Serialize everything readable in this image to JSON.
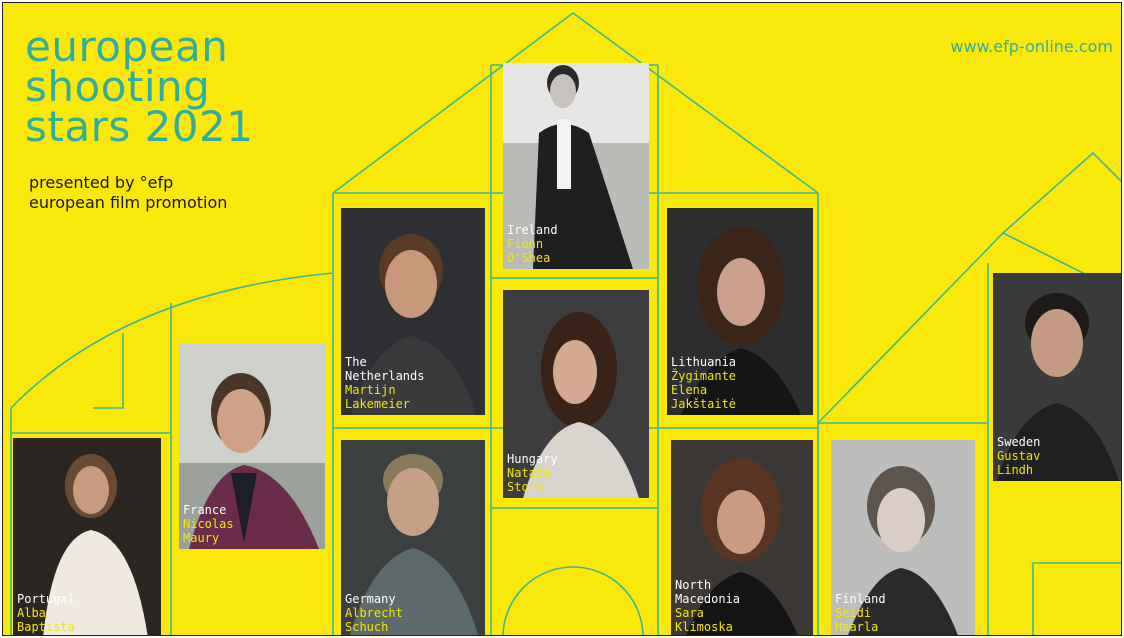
{
  "poster": {
    "title_lines": [
      "european",
      "shooting",
      "stars 2021"
    ],
    "subtitle_lines": [
      "presented by °efp",
      "european film promotion"
    ],
    "url": "www.efp-online.com",
    "background_color": "#fbe80b",
    "accent_color": "#2fae9e"
  },
  "stars": [
    {
      "country": "Portugal",
      "name_lines": [
        "Alba",
        "Baptista"
      ],
      "bg": "dark"
    },
    {
      "country": "France",
      "name_lines": [
        "Nicolas",
        "Maury"
      ],
      "bg": "light"
    },
    {
      "country": "The\nNetherlands",
      "country_lines": [
        "The",
        "Netherlands"
      ],
      "name_lines": [
        "Martijn",
        "Lakemeier"
      ],
      "bg": "dark"
    },
    {
      "country": "Germany",
      "name_lines": [
        "Albrecht",
        "Schuch"
      ],
      "bg": "dark"
    },
    {
      "country": "Ireland",
      "name_lines": [
        "Fionn",
        "O'Shea"
      ],
      "bg": "light"
    },
    {
      "country": "Hungary",
      "name_lines": [
        "Nataša",
        "Stork"
      ],
      "bg": "dark"
    },
    {
      "country": "Lithuania",
      "name_lines": [
        "Žygimante",
        "Elena",
        "Jakštaitė"
      ],
      "bg": "dark"
    },
    {
      "country": "North\nMacedonia",
      "country_lines": [
        "North",
        "Macedonia"
      ],
      "name_lines": [
        "Sara",
        "Klimoska"
      ],
      "bg": "dark"
    },
    {
      "country": "Finland",
      "name_lines": [
        "Seidi",
        "Haarla"
      ],
      "bg": "light"
    },
    {
      "country": "Sweden",
      "name_lines": [
        "Gustav",
        "Lindh"
      ],
      "bg": "dark"
    }
  ]
}
